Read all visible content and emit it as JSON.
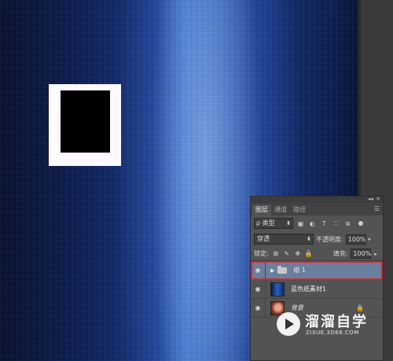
{
  "colors": {
    "canvas_dark": "#0b1330",
    "canvas_highlight": "#3a72d1",
    "panel_bg": "#535353",
    "selection": "#6a7f9e",
    "highlight_box": "#d9262b"
  },
  "panel": {
    "tabs": [
      "图层",
      "通道",
      "路径"
    ],
    "filter": {
      "label": "ρ 类型"
    },
    "blend_mode": "穿透",
    "opacity_label": "不透明度:",
    "opacity_value": "100%",
    "lock_label": "锁定:",
    "fill_label": "填充:",
    "fill_value": "100%",
    "layers": [
      {
        "name": "组 1",
        "type": "group",
        "selected": true,
        "icon": "folder-icon"
      },
      {
        "name": "蓝色纸素材1",
        "type": "image",
        "selected": false,
        "icon": "blue-texture-thumb"
      },
      {
        "name": "背景",
        "type": "background",
        "selected": false,
        "locked": true,
        "icon": "portrait-thumb"
      }
    ]
  },
  "watermark": {
    "title": "溜溜自学",
    "subtitle": "ZIXUE.3D66.COM"
  }
}
